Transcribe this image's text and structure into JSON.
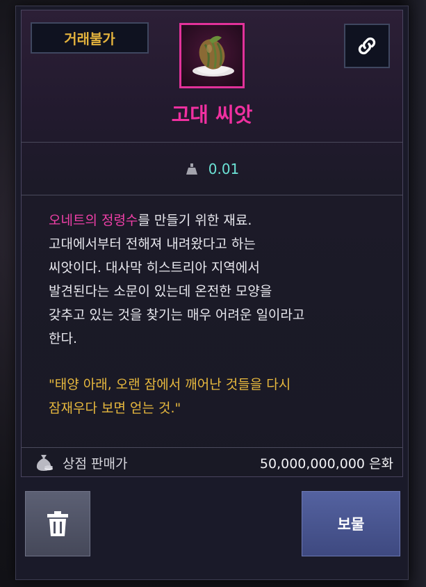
{
  "item": {
    "trade_status": "거래불가",
    "name": "고대 씨앗",
    "weight": "0.01",
    "description_highlight": "오네트의 정령수",
    "description_line1_rest": "를 만들기 위한 재료.",
    "description_lines": [
      "고대에서부터 전해져 내려왔다고 하는",
      "씨앗이다. 대사막 히스트리아 지역에서",
      "발견된다는 소문이 있는데 온전한 모양을",
      "갖추고 있는 것을 찾기는 매우 어려운 일이라고",
      "한다."
    ],
    "quote_lines": [
      "\"태양 아래, 오랜 잠에서 깨어난 것들을 다시",
      "잠재우다 보면 얻는 것.\""
    ],
    "shop_price_label": "상점 판매가",
    "shop_price_value": "50,000,000,000 은화"
  },
  "actions": {
    "vault_label": "보물"
  },
  "colors": {
    "name_color": "#f030a0",
    "trade_badge_text": "#e3b23d",
    "weight_text": "#6ce3d6",
    "quote_text": "#e8b93e"
  },
  "icons": {
    "link": "chain-link-icon",
    "weight": "weight-icon",
    "coin_bag": "coin-bag-icon",
    "trash": "trash-icon",
    "item": "ancient-seed-icon"
  }
}
